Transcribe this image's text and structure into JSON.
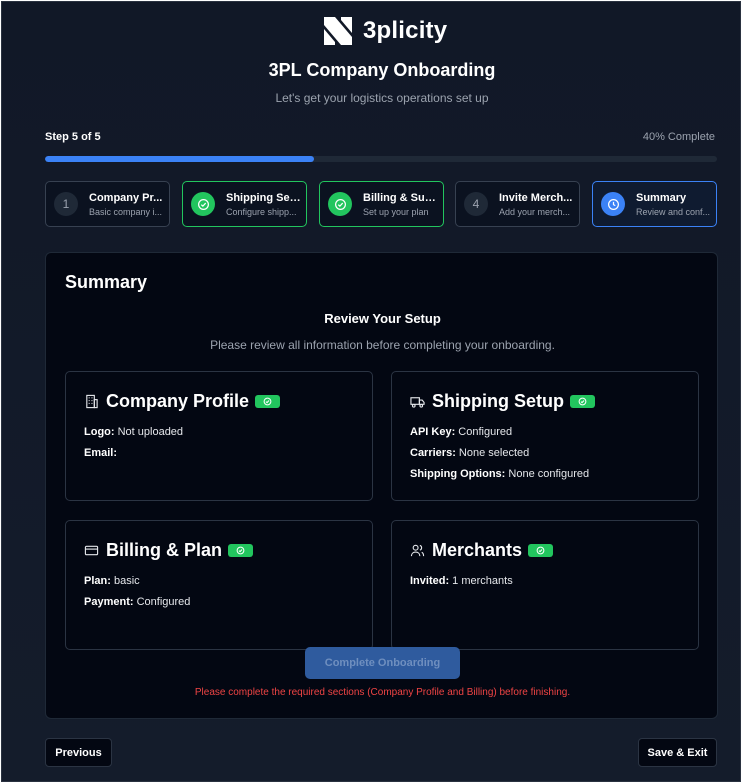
{
  "brand": {
    "name": "3plicity",
    "logo_icon": "n-logo-mark"
  },
  "header": {
    "title": "3PL Company Onboarding",
    "subtitle": "Let's get your logistics operations set up"
  },
  "progress": {
    "step_label": "Step 5 of 5",
    "percent_label": "40% Complete",
    "percent": 40
  },
  "colors": {
    "accent": "#3b82f6",
    "success": "#22c55e",
    "error": "#ef4444",
    "background": "#111827"
  },
  "steps": [
    {
      "number": "1",
      "title": "Company Pr...",
      "desc": "Basic company i...",
      "status": "pending",
      "icon": ""
    },
    {
      "number": "",
      "title": "Shipping Set...",
      "desc": "Configure shipp...",
      "status": "done",
      "icon": "check-circle-icon"
    },
    {
      "number": "",
      "title": "Billing & Sub...",
      "desc": "Set up your plan",
      "status": "done",
      "icon": "check-circle-icon"
    },
    {
      "number": "4",
      "title": "Invite Merch...",
      "desc": "Add your merch...",
      "status": "pending",
      "icon": ""
    },
    {
      "number": "",
      "title": "Summary",
      "desc": "Review and conf...",
      "status": "active",
      "icon": "clock-icon"
    }
  ],
  "summary": {
    "title": "Summary",
    "review_title": "Review Your Setup",
    "review_subtitle": "Please review all information before completing your onboarding.",
    "cards": {
      "company": {
        "title": "Company Profile",
        "icon": "building-icon",
        "lines": [
          {
            "label": "Logo:",
            "value": " Not uploaded"
          },
          {
            "label": "Email:",
            "value": ""
          }
        ]
      },
      "shipping": {
        "title": "Shipping Setup",
        "icon": "truck-icon",
        "lines": [
          {
            "label": "API Key:",
            "value": " Configured"
          },
          {
            "label": "Carriers:",
            "value": " None selected"
          },
          {
            "label": "Shipping Options:",
            "value": " None configured"
          }
        ]
      },
      "billing": {
        "title": "Billing & Plan",
        "icon": "credit-card-icon",
        "lines": [
          {
            "label": "Plan:",
            "value": " basic"
          },
          {
            "label": "Payment:",
            "value": " Configured"
          }
        ]
      },
      "merchants": {
        "title": "Merchants",
        "icon": "users-icon",
        "lines": [
          {
            "label": "Invited:",
            "value": " 1 merchants"
          }
        ]
      }
    },
    "complete_button": "Complete Onboarding",
    "error": "Please complete the required sections (Company Profile and Billing) before finishing."
  },
  "footer": {
    "previous": "Previous",
    "save_exit": "Save & Exit"
  }
}
